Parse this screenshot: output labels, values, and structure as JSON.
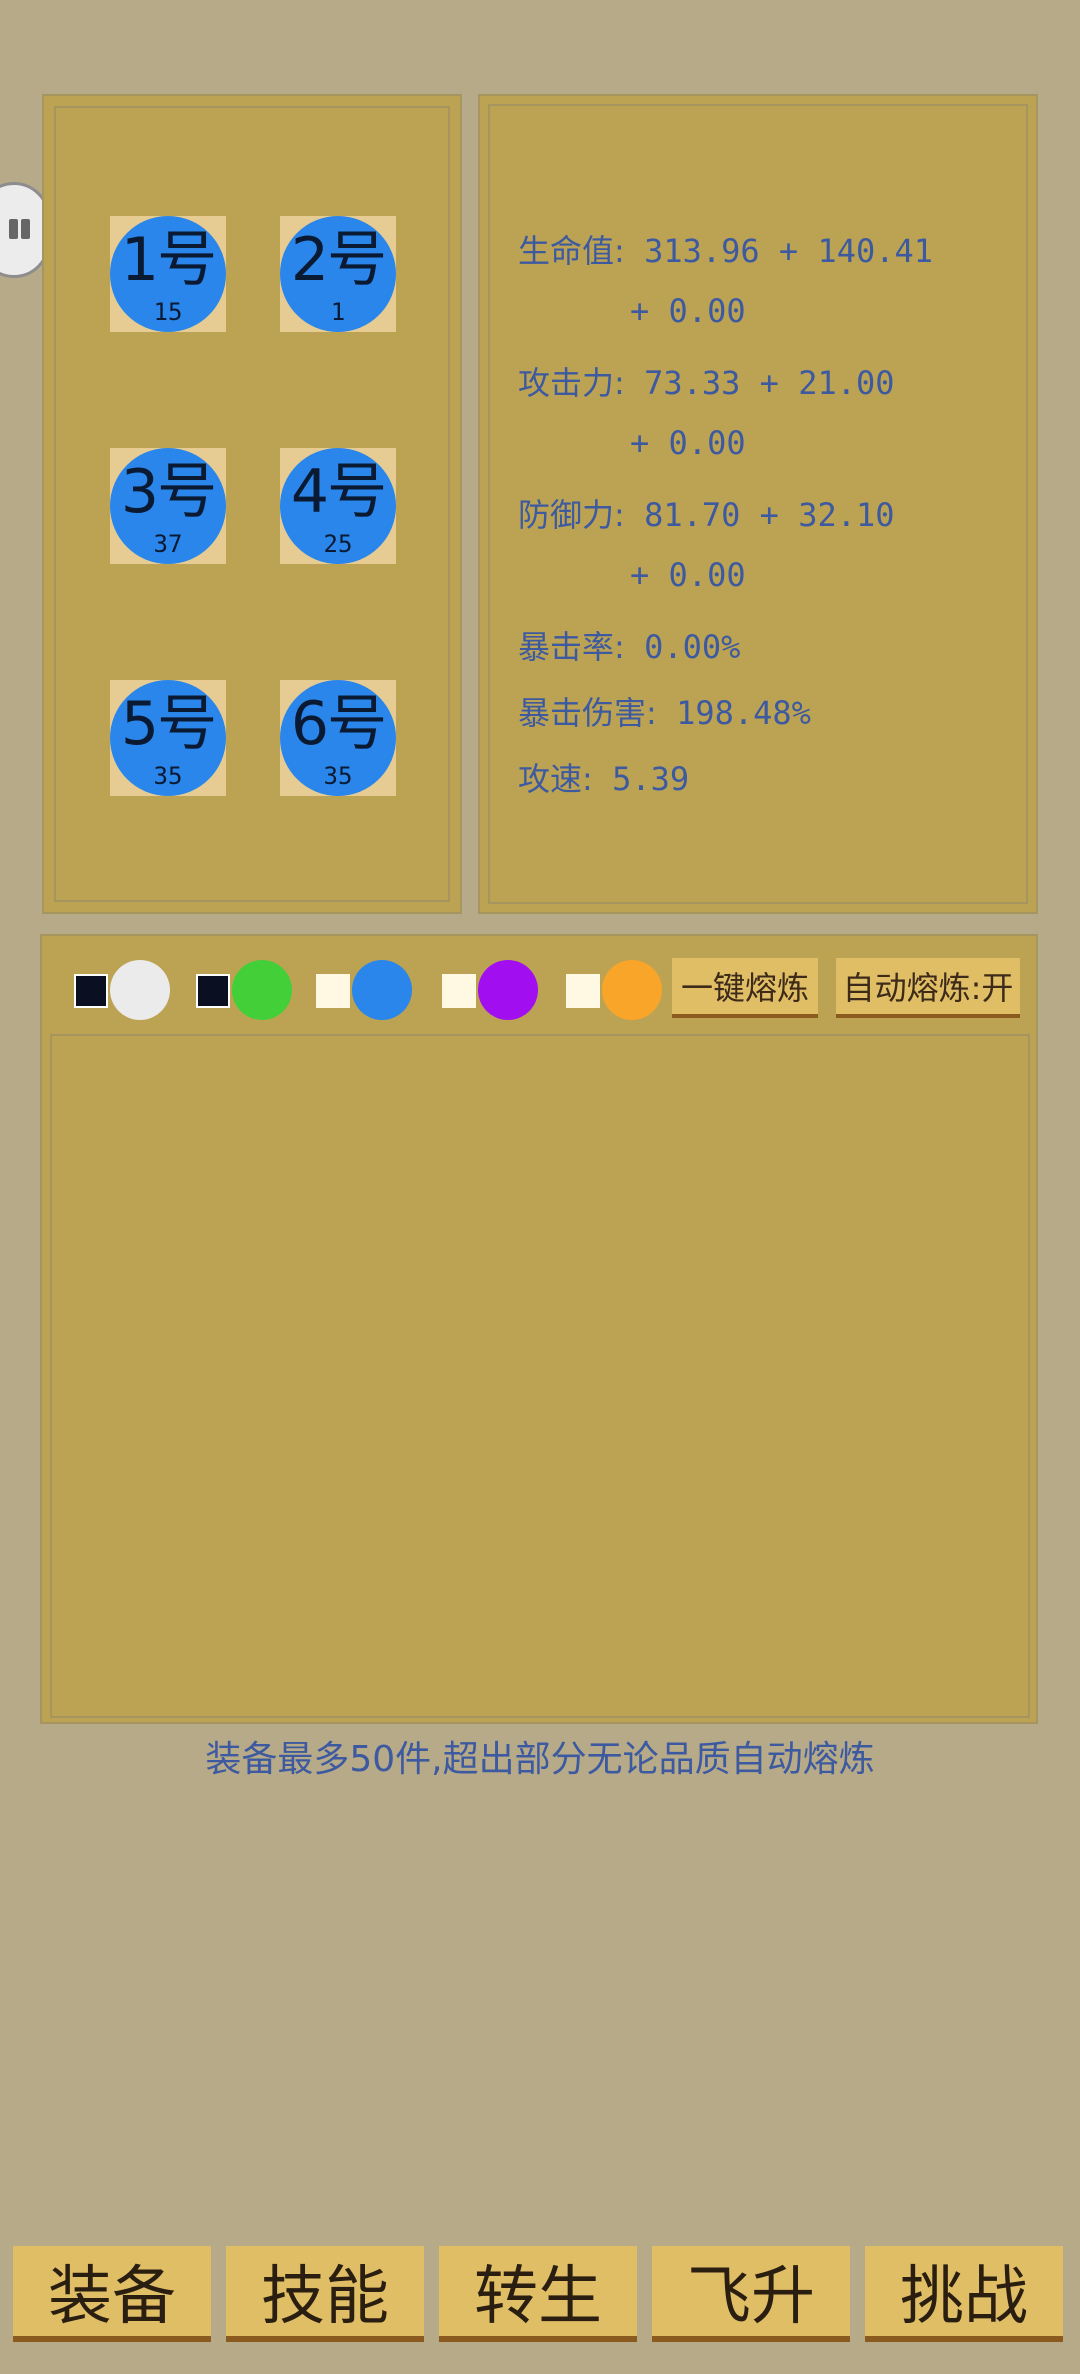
{
  "slots": [
    {
      "label": "1号",
      "level": "15"
    },
    {
      "label": "2号",
      "level": "1"
    },
    {
      "label": "3号",
      "level": "37"
    },
    {
      "label": "4号",
      "level": "25"
    },
    {
      "label": "5号",
      "level": "35"
    },
    {
      "label": "6号",
      "level": "35"
    }
  ],
  "stats": {
    "hp_label": "生命值:",
    "hp_value": "313.96 + 140.41",
    "hp_extra": "+ 0.00",
    "atk_label": "攻击力:",
    "atk_value": "73.33 + 21.00",
    "atk_extra": "+ 0.00",
    "def_label": "防御力:",
    "def_value": "81.70 + 32.10",
    "def_extra": "+ 0.00",
    "crit_rate_label": "暴击率:",
    "crit_rate_value": "0.00%",
    "crit_dmg_label": "暴击伤害:",
    "crit_dmg_value": "198.48%",
    "speed_label": "攻速:",
    "speed_value": "5.39"
  },
  "filters": [
    {
      "checked": true,
      "color": "#ebebeb"
    },
    {
      "checked": true,
      "color": "#42cf38"
    },
    {
      "checked": false,
      "color": "#2a86ea"
    },
    {
      "checked": false,
      "color": "#a10ff0"
    },
    {
      "checked": false,
      "color": "#f8a52a"
    }
  ],
  "buttons": {
    "smelt_all": "一键熔炼",
    "auto_smelt": "自动熔炼:开"
  },
  "notice": "装备最多50件,超出部分无论品质自动熔炼",
  "nav": {
    "equip": "装备",
    "skill": "技能",
    "rebirth": "转生",
    "ascend": "飞升",
    "challenge": "挑战"
  },
  "colors": {
    "background": "#b7aa88",
    "panel": "#bca353",
    "text_blue": "#3d5aa0",
    "button": "#e0be66",
    "slot_circle": "#2a86ea"
  }
}
